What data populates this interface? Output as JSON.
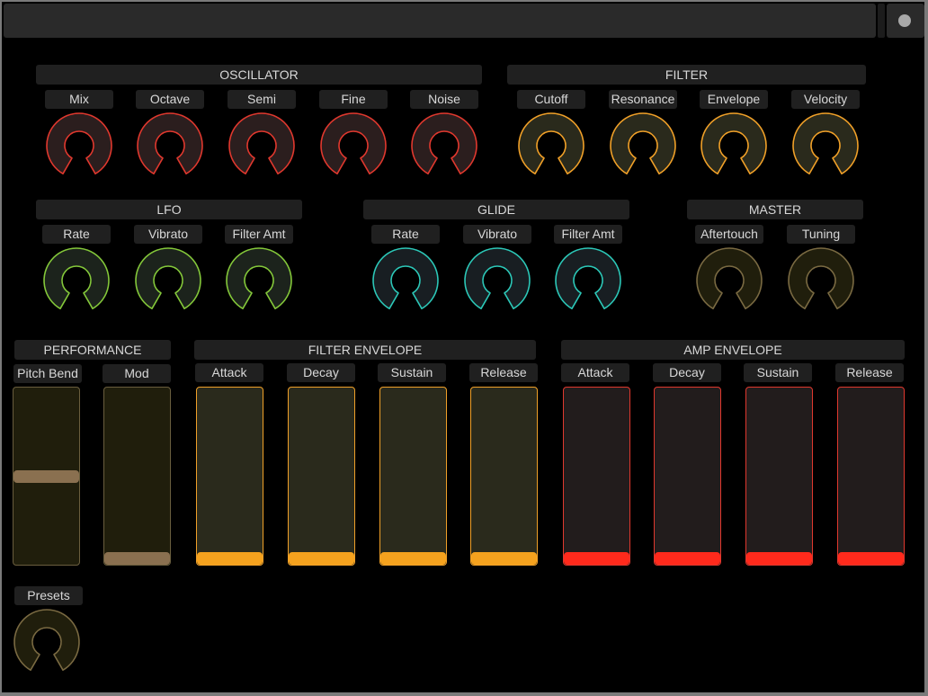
{
  "colors": {
    "red": {
      "stroke": "#e0382e",
      "fill": "#2b1e1e"
    },
    "orange": {
      "stroke": "#f0a028",
      "fill": "#2a2a1c"
    },
    "green": {
      "stroke": "#84c83a",
      "fill": "#1c231c"
    },
    "cyan": {
      "stroke": "#2cc8b8",
      "fill": "#181e22"
    },
    "brown": {
      "stroke": "#7a6a42",
      "fill": "#201e0c"
    }
  },
  "sections": {
    "oscillator": "OSCILLATOR",
    "filter": "FILTER",
    "lfo": "LFO",
    "glide": "GLIDE",
    "master": "MASTER",
    "performance": "PERFORMANCE",
    "filter_envelope": "FILTER ENVELOPE",
    "amp_envelope": "AMP ENVELOPE"
  },
  "knobs": {
    "osc_mix": "Mix",
    "osc_octave": "Octave",
    "osc_semi": "Semi",
    "osc_fine": "Fine",
    "osc_noise": "Noise",
    "flt_cutoff": "Cutoff",
    "flt_resonance": "Resonance",
    "flt_envelope": "Envelope",
    "flt_velocity": "Velocity",
    "lfo_rate": "Rate",
    "lfo_vibrato": "Vibrato",
    "lfo_filter_amt": "Filter Amt",
    "gl_rate": "Rate",
    "gl_vibrato": "Vibrato",
    "gl_filter_amt": "Filter Amt",
    "ms_aftertouch": "Aftertouch",
    "ms_tuning": "Tuning",
    "presets": "Presets"
  },
  "faders": {
    "pitch_bend": "Pitch Bend",
    "mod": "Mod",
    "fe_attack": "Attack",
    "fe_decay": "Decay",
    "fe_sustain": "Sustain",
    "fe_release": "Release",
    "ae_attack": "Attack",
    "ae_decay": "Decay",
    "ae_sustain": "Sustain",
    "ae_release": "Release"
  },
  "fader_values": {
    "pitch_bend": 0.5,
    "mod": 0.0,
    "fe_attack": 0.0,
    "fe_decay": 0.0,
    "fe_sustain": 0.0,
    "fe_release": 0.0,
    "ae_attack": 0.0,
    "ae_decay": 0.0,
    "ae_sustain": 0.0,
    "ae_release": 0.0
  }
}
